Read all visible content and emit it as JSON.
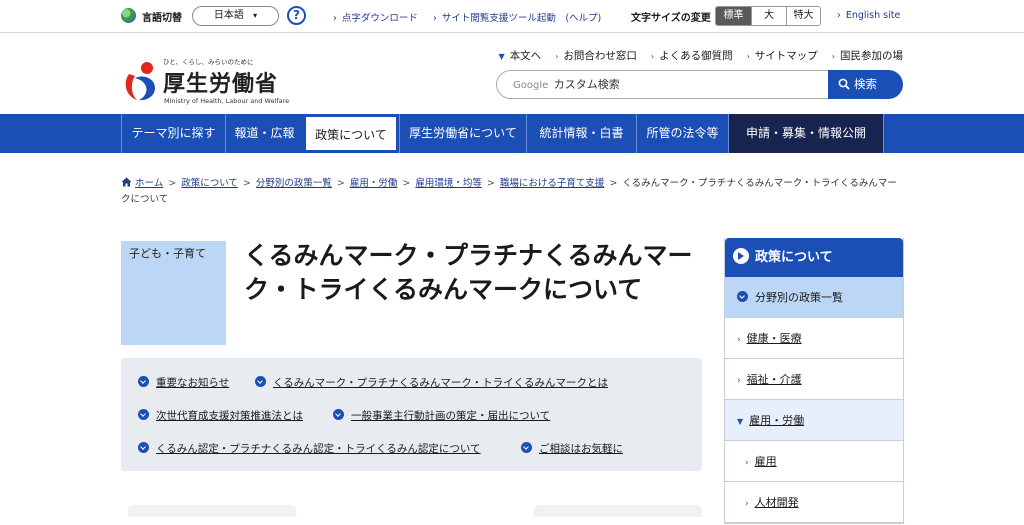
{
  "utility": {
    "language_label": "言語切替",
    "language_value": "日本語",
    "help_glyph": "?",
    "links": [
      "点字ダウンロード",
      "サイト閲覧支援ツール起動　(ヘルプ)"
    ],
    "font_size_label": "文字サイズの変更",
    "font_sizes": [
      "標準",
      "大",
      "特大"
    ],
    "english_link": "English site"
  },
  "logo": {
    "tagline": "ひと、くらし、みらいのために",
    "name": "厚生労働省",
    "english": "Ministry of Health, Labour and Welfare"
  },
  "header_nav": [
    "本文へ",
    "お問合わせ窓口",
    "よくある御質問",
    "サイトマップ",
    "国民参加の場"
  ],
  "search": {
    "brand": "Google",
    "placeholder": "カスタム検索",
    "button": "検索"
  },
  "global_nav": [
    {
      "label": "テーマ別に探す"
    },
    {
      "label": "報道・広報"
    },
    {
      "label": "政策について",
      "active": true
    },
    {
      "label": "厚生労働省について"
    },
    {
      "label": "統計情報・白書"
    },
    {
      "label": "所管の法令等"
    },
    {
      "label": "申請・募集・情報公開",
      "dark": true
    }
  ],
  "breadcrumb": {
    "items": [
      "ホーム",
      "政策について",
      "分野別の政策一覧",
      "雇用・労働",
      "雇用環境・均等",
      "職場における子育て支援"
    ],
    "current": "くるみんマーク・プラチナくるみんマーク・トライくるみんマークについて"
  },
  "category_tag": "子ども・子育て",
  "page_title": "くるみんマーク・プラチナくるみんマーク・トライくるみんマークについて",
  "anchors": [
    "重要なお知らせ",
    "くるみんマーク・プラチナくるみんマーク・トライくるみんマークとは",
    "次世代育成支援対策推進法とは",
    "一般事業主行動計画の策定・届出について",
    "くるみん認定・プラチナくるみん認定・トライくるみん認定について",
    "ご相談はお気軽に"
  ],
  "side_nav": {
    "title": "政策について",
    "section": "分野別の政策一覧",
    "items": [
      {
        "label": "健康・医療",
        "level": 1
      },
      {
        "label": "福祉・介護",
        "level": 1
      },
      {
        "label": "雇用・労働",
        "level": 1,
        "open": true
      },
      {
        "label": "雇用",
        "level": 2
      },
      {
        "label": "人材開発",
        "level": 2
      }
    ]
  },
  "colors": {
    "primary_blue": "#1b4fb5",
    "light_blue": "#bcd6f6",
    "dark_nav": "#17244f",
    "anchor_bg": "#e8ebf0"
  }
}
